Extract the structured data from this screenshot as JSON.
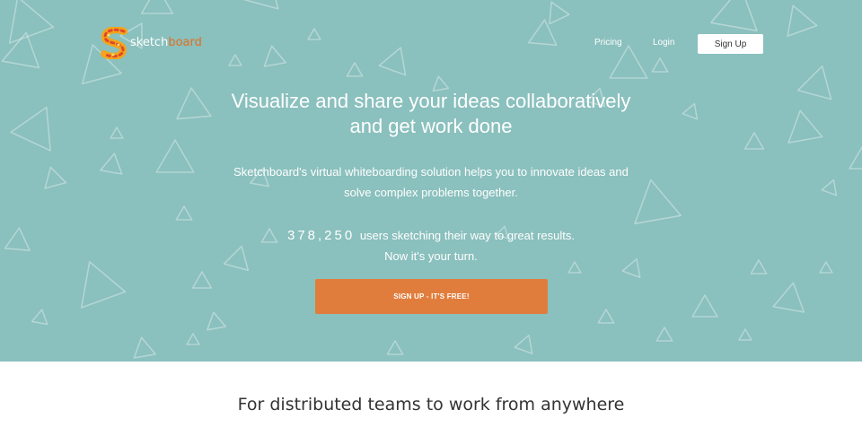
{
  "brand": {
    "name_part1": "sketch",
    "name_part2": "board",
    "logo_icon": "s-logo-icon",
    "accent_color": "#e36f21"
  },
  "nav": {
    "pricing": "Pricing",
    "login": "Login",
    "signup": "Sign Up"
  },
  "hero": {
    "background_color": "#8ac0bd",
    "pattern": "triangle-outline-pattern",
    "headline_line1": "Visualize and share your ideas collaboratively",
    "headline_line2": "and get work done",
    "sub_line1": "Sketchboard's virtual whiteboarding solution helps you to innovate ideas and",
    "sub_line2": "solve complex problems together.",
    "user_count": "378,250",
    "stats_suffix": " users sketching their way to great results.",
    "stats_line2": "Now it's your turn.",
    "cta": "SIGN UP - IT'S FREE!",
    "cta_color": "#e17d3c"
  },
  "features": {
    "title": "For distributed teams to work from anywhere"
  }
}
